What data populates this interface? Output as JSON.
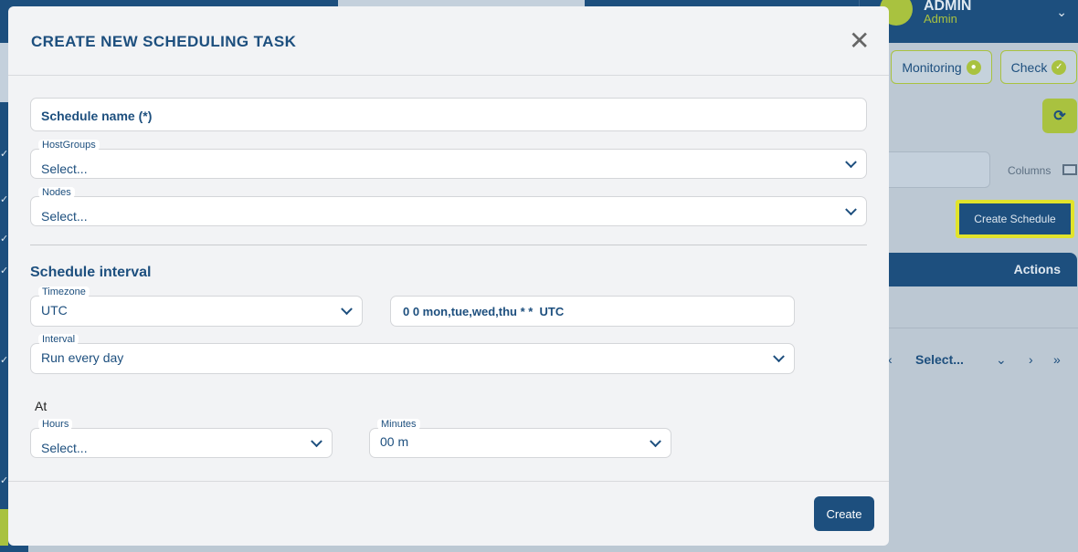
{
  "header": {
    "user_name": "ADMIN",
    "user_role": "Admin"
  },
  "toolbar": {
    "monitoring_label": "Monitoring",
    "check_label": "Check",
    "columns_label": "Columns",
    "create_schedule_label": "Create Schedule"
  },
  "table": {
    "actions_header": "Actions",
    "pager_select": "Select..."
  },
  "modal": {
    "title": "CREATE NEW SCHEDULING TASK",
    "schedule_name_placeholder": "Schedule name (*)",
    "hostgroups": {
      "label": "HostGroups",
      "value": "Select..."
    },
    "nodes": {
      "label": "Nodes",
      "value": "Select..."
    },
    "section_title": "Schedule interval",
    "timezone": {
      "label": "Timezone",
      "value": "UTC"
    },
    "cron_expression": "0 0 mon,tue,wed,thu * *  UTC",
    "interval": {
      "label": "Interval",
      "value": "Run every day"
    },
    "at_label": "At",
    "hours": {
      "label": "Hours",
      "value": "Select..."
    },
    "minutes": {
      "label": "Minutes",
      "value": "00 m"
    },
    "create_label": "Create"
  },
  "colors": {
    "primary": "#1d4f7e",
    "accent": "#a9c23f",
    "highlight": "#e1e32b"
  }
}
